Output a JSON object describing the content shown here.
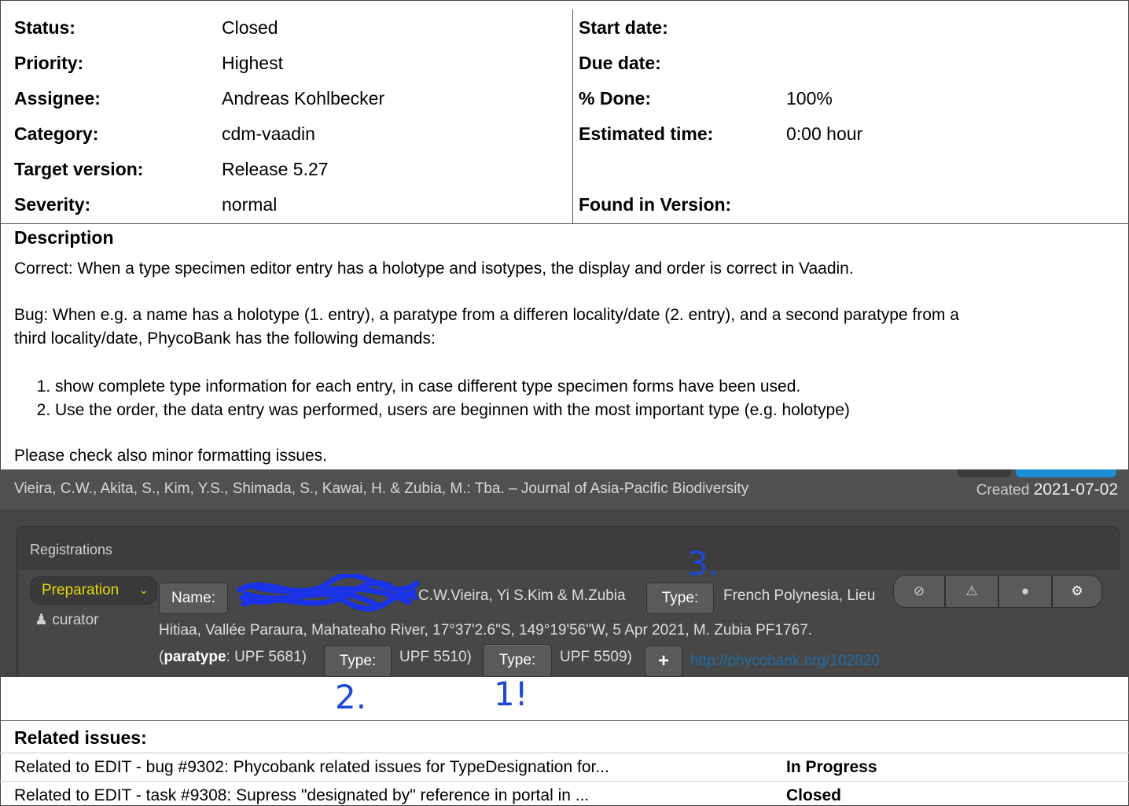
{
  "attributes": {
    "status": {
      "label": "Status:",
      "value": "Closed"
    },
    "priority": {
      "label": "Priority:",
      "value": "Highest"
    },
    "assignee": {
      "label": "Assignee:",
      "value": "Andreas Kohlbecker"
    },
    "category": {
      "label": "Category:",
      "value": "cdm-vaadin"
    },
    "target_version": {
      "label": "Target version:",
      "value": "Release 5.27"
    },
    "severity": {
      "label": "Severity:",
      "value": "normal"
    },
    "start_date": {
      "label": "Start date:",
      "value": ""
    },
    "due_date": {
      "label": "Due date:",
      "value": ""
    },
    "done": {
      "label": "% Done:",
      "value": "100%"
    },
    "estimated_time": {
      "label": "Estimated time:",
      "value": "0:00 hour"
    },
    "found_in_version": {
      "label": "Found in Version:",
      "value": ""
    }
  },
  "description": {
    "title": "Description",
    "para1": "Correct: When a type specimen editor entry has a holotype and isotypes, the display and order is correct in Vaadin.",
    "para2_line1": "Bug: When e.g. a name has a holotype (1. entry), a paratype from a differen locality/date (2. entry), and a second paratype from a",
    "para2_line2": "third locality/date, PhycoBank has the following demands:",
    "demands": [
      "show complete type information for each entry, in case different type specimen forms have been used.",
      "Use the order, the data entry was performed, users are beginnen with the most important type (e.g. holotype)"
    ],
    "para3": "Please check also minor formatting issues."
  },
  "screenshot": {
    "reference": "Vieira, C.W., Akita, S., Kim, Y.S., Shimada, S., Kawai, H. & Zubia, M.: Tba. – Journal of Asia-Pacific Biodiversity",
    "created_label": "Created",
    "created_date": "2021-07-02",
    "panel_title": "Registrations",
    "state": "Preparation",
    "user": "curator",
    "name_button": "Name:",
    "name_text": "C.W.Vieira, Yi S.Kim & M.Zubia",
    "type_button": "Type:",
    "type_text_1": "French Polynesia, Lieu",
    "type_text_2": "Hitiaa, Vallée Paraura, Mahateaho River, 17°37'2.6\"S, 149°19'56\"W, 5 Apr 2021, M. Zubia PF1767.",
    "paratype_prefix": "(",
    "paratype_bold": "paratype",
    "paratype_rest": ": UPF 5681)",
    "upf_5510": "UPF 5510)",
    "upf_5509": "UPF 5509)",
    "plus": "+",
    "link": "http://phycobank.org/102820",
    "annotations": [
      "3.",
      "2.",
      "1!"
    ]
  },
  "related": {
    "title": "Related issues:",
    "items": [
      {
        "text": "Related to EDIT - bug #9302: Phycobank related issues for TypeDesignation for...",
        "status": "In Progress"
      },
      {
        "text": "Related to EDIT - task #9308: Supress \"designated by\" reference in portal in ...",
        "status": "Closed"
      }
    ]
  }
}
